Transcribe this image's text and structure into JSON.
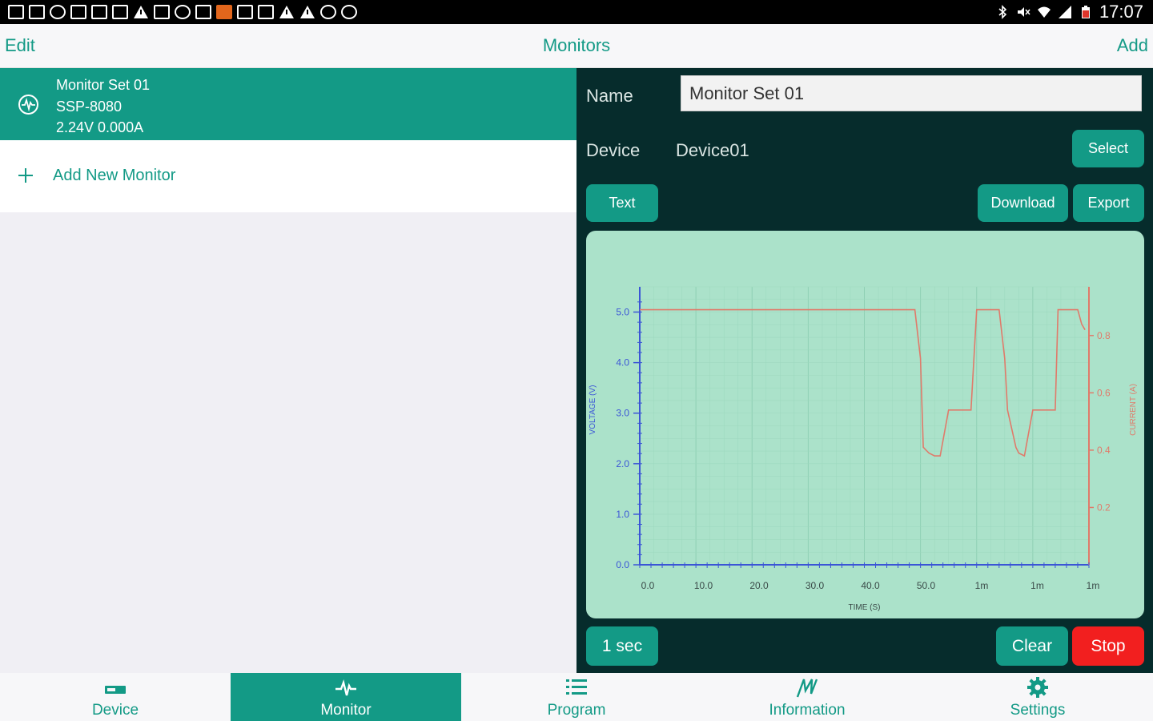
{
  "status_bar": {
    "time": "17:07",
    "left_icons": [
      "facebook-icon",
      "usb-icon",
      "chat-icon",
      "screenshot-icon",
      "mail-icon",
      "calendar-icon",
      "warning-icon",
      "mail-icon",
      "sync-icon",
      "app-icon",
      "app-orange-icon",
      "document-icon",
      "message-icon",
      "warning-icon",
      "warning-icon",
      "cloud-icon",
      "cloud-icon"
    ],
    "right_icons": [
      "bluetooth-icon",
      "mute-icon",
      "wifi-icon",
      "signal-icon",
      "battery-icon"
    ]
  },
  "navbar": {
    "edit_label": "Edit",
    "title": "Monitors",
    "add_label": "Add"
  },
  "monitor_list": {
    "items": [
      {
        "name": "Monitor Set 01",
        "model": "SSP-8080",
        "reading": "2.24V 0.000A"
      }
    ],
    "add_label": "Add New Monitor"
  },
  "detail": {
    "name_label": "Name",
    "name_value": "Monitor Set 01",
    "device_label": "Device",
    "device_value": "Device01",
    "select_label": "Select",
    "text_label": "Text",
    "download_label": "Download",
    "export_label": "Export",
    "interval_label": "1 sec",
    "clear_label": "Clear",
    "stop_label": "Stop"
  },
  "colors": {
    "accent": "#139a86",
    "panel_dark": "#062c2c",
    "chart_bg": "#abe2ca",
    "voltage": "#3b55d6",
    "current": "#e07a6a",
    "stop": "#f21f1f"
  },
  "chart_data": {
    "type": "line",
    "xlabel": "TIME (S)",
    "ylabel": "VOLTAGE (V)",
    "y2label": "CURRENT (A)",
    "x_tick_labels": [
      "0.0",
      "10.0",
      "20.0",
      "30.0",
      "40.0",
      "50.0",
      "1m",
      "1m",
      "1m"
    ],
    "xlim": [
      0,
      80
    ],
    "ylim": [
      0,
      5.5
    ],
    "y_ticks": [
      0.0,
      1.0,
      2.0,
      3.0,
      4.0,
      5.0
    ],
    "y_tick_labels": [
      "0.0",
      "1.0",
      "2.0",
      "3.0",
      "4.0",
      "5.0"
    ],
    "y2lim": [
      0,
      0.97
    ],
    "y2_ticks": [
      0.2,
      0.4,
      0.6,
      0.8
    ],
    "y2_tick_labels": [
      "0.2",
      "0.4",
      "0.6",
      "0.8"
    ],
    "grid": true,
    "series": [
      {
        "axis": "right",
        "x": [
          0,
          49,
          50,
          50.5,
          51.5,
          52.5,
          53.5,
          55,
          59,
          60,
          60.5,
          61,
          64,
          65,
          65.5,
          67,
          67.5,
          68.5,
          70,
          74,
          74.5,
          75,
          78,
          78.7,
          79.3
        ],
        "y": [
          0.89,
          0.89,
          0.72,
          0.41,
          0.39,
          0.38,
          0.38,
          0.54,
          0.54,
          0.89,
          0.89,
          0.89,
          0.89,
          0.72,
          0.54,
          0.41,
          0.39,
          0.38,
          0.54,
          0.54,
          0.89,
          0.89,
          0.89,
          0.84,
          0.82
        ]
      }
    ]
  },
  "tabs": [
    {
      "label": "Device",
      "icon": "device-icon",
      "active": false
    },
    {
      "label": "Monitor",
      "icon": "pulse-icon",
      "active": true
    },
    {
      "label": "Program",
      "icon": "list-icon",
      "active": false
    },
    {
      "label": "Information",
      "icon": "logo-icon",
      "active": false
    },
    {
      "label": "Settings",
      "icon": "gear-icon",
      "active": false
    }
  ]
}
